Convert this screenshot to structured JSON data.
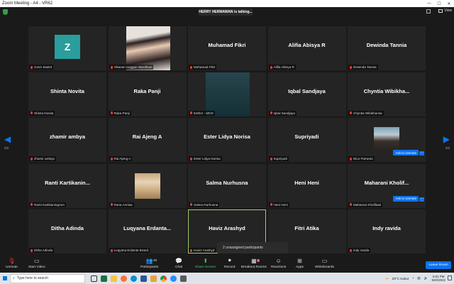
{
  "window": {
    "title": "Zoom Meeting - A4 - VR62"
  },
  "banner": {
    "talking": "HERRY HERMAWAN is talking..."
  },
  "topbar": {
    "view_label": "View"
  },
  "nav": {
    "page_left": "2/2",
    "page_right": "2/2"
  },
  "tiles": [
    {
      "display": "",
      "label": "zoom 8aa04",
      "avatar": "Z"
    },
    {
      "display": "",
      "label": "Vikasari Anggun Wardhani"
    },
    {
      "display": "Muhamad Fikri",
      "label": "Muhamad Fikri"
    },
    {
      "display": "Alifia Abisya R",
      "label": "Alifia Abisya R"
    },
    {
      "display": "Dewinda Tannia",
      "label": "Dewinda Tannia"
    },
    {
      "display": "Shinta Novita",
      "label": "Shinta Novita"
    },
    {
      "display": "Raka Panji",
      "label": "Raka Panji"
    },
    {
      "display": "",
      "label": "Esther - MOX"
    },
    {
      "display": "Iqbal Sandjaya",
      "label": "Iqbal Sandjaya"
    },
    {
      "display": "Chyntia Wibikha...",
      "label": "Chyntia Wibikhansa"
    },
    {
      "display": "zhamir ambya",
      "label": "zhamir ambya"
    },
    {
      "display": "Rai Ajeng A",
      "label": "Rai Ajeng A"
    },
    {
      "display": "Ester Lidya Norisa",
      "label": "Ester Lidya Norisa"
    },
    {
      "display": "Supriyadi",
      "label": "Supriyadi"
    },
    {
      "display": "",
      "label": "Nico Putranto",
      "button": "Ask to Unmute"
    },
    {
      "display": "Ranti Kartikanin...",
      "label": "Ranti Kartikaningrum"
    },
    {
      "display": "",
      "label": "Rana Annisa"
    },
    {
      "display": "Salma Nurhusna",
      "label": "Salma Nurhusna"
    },
    {
      "display": "Heni Heni",
      "label": "Heni Heni"
    },
    {
      "display": "Maharani Kholif...",
      "label": "Maharani Kholifatul",
      "button": "Ask to Unmute"
    },
    {
      "display": "Ditha Adinda",
      "label": "Ditha Adinda"
    },
    {
      "display": "Luqyana Erdanta...",
      "label": "Luqyana Erdanta Brand"
    },
    {
      "display": "Haviz Arashyd",
      "label": "Haviz Arashyd"
    },
    {
      "display": "Fitri Atika",
      "label": "Fitri Atika"
    },
    {
      "display": "Indy ravida",
      "label": "indy ravida"
    }
  ],
  "unassigned": {
    "label": "2 unassigned participants"
  },
  "toolbar": {
    "unmute": "Unmute",
    "start_video": "Start Video",
    "participants": "Participants",
    "participants_count": "26",
    "chat": "Chat",
    "share_screen": "Share Screen",
    "record": "Record",
    "breakout_rooms": "Breakout Rooms",
    "breakout_badge": "2",
    "reactions": "Reactions",
    "apps": "Apps",
    "whiteboards": "Whiteboards",
    "leave": "Leave Room"
  },
  "taskbar": {
    "search_placeholder": "Type here to search",
    "weather": "29°C Kabut",
    "time": "6:51 PM",
    "date": "9/20/2022"
  },
  "colors": {
    "accent": "#0e72ed",
    "share_green": "#3dcc5f",
    "mute_red": "#e53935"
  }
}
